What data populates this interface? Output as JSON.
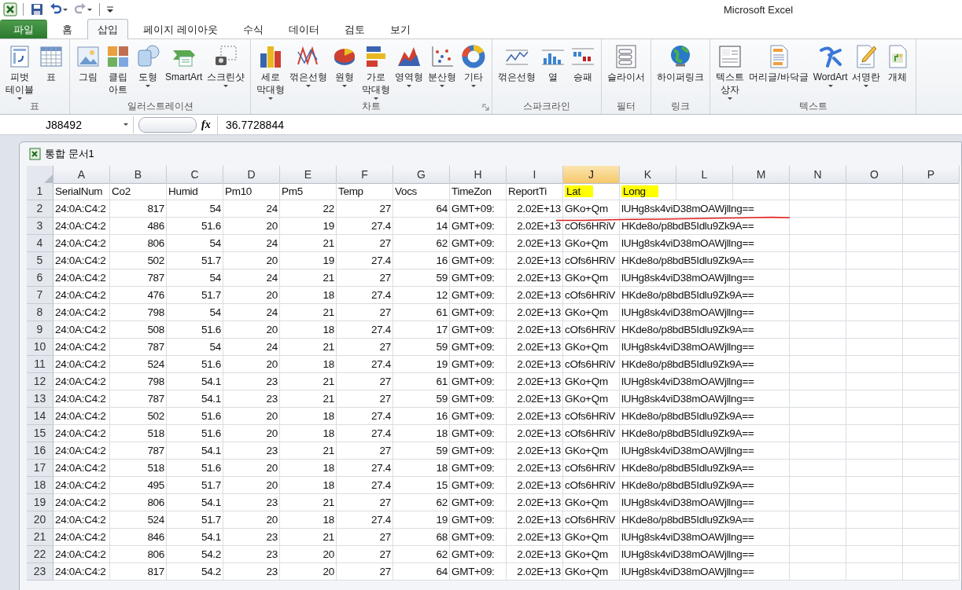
{
  "window": {
    "title": "Microsoft Excel"
  },
  "quick_access": [
    {
      "kind": "save",
      "dropdown": false
    },
    {
      "kind": "undo",
      "dropdown": true
    },
    {
      "kind": "redo",
      "dropdown": true
    },
    {
      "kind": "customize",
      "dropdown": false
    }
  ],
  "tabs": [
    {
      "label": "파일",
      "kind": "file",
      "selected": false
    },
    {
      "label": "홈",
      "kind": "tab",
      "selected": false
    },
    {
      "label": "삽입",
      "kind": "tab",
      "selected": true
    },
    {
      "label": "페이지 레이아웃",
      "kind": "tab",
      "selected": false
    },
    {
      "label": "수식",
      "kind": "tab",
      "selected": false
    },
    {
      "label": "데이터",
      "kind": "tab",
      "selected": false
    },
    {
      "label": "검토",
      "kind": "tab",
      "selected": false
    },
    {
      "label": "보기",
      "kind": "tab",
      "selected": false
    }
  ],
  "ribbon": {
    "groups": [
      {
        "label": "표",
        "launcher": false,
        "items": [
          {
            "label": "피벗\n테이블",
            "dropdown": true
          },
          {
            "label": "표",
            "dropdown": false
          }
        ]
      },
      {
        "label": "일러스트레이션",
        "launcher": false,
        "items": [
          {
            "label": "그림",
            "dropdown": false
          },
          {
            "label": "클립\n아트",
            "dropdown": false
          },
          {
            "label": "도형",
            "dropdown": true
          },
          {
            "label": "SmartArt",
            "dropdown": false
          },
          {
            "label": "스크린샷",
            "dropdown": true
          }
        ]
      },
      {
        "label": "차트",
        "launcher": true,
        "items": [
          {
            "label": "세로\n막대형",
            "dropdown": true
          },
          {
            "label": "꺾은선형",
            "dropdown": true
          },
          {
            "label": "원형",
            "dropdown": true
          },
          {
            "label": "가로\n막대형",
            "dropdown": true
          },
          {
            "label": "영역형",
            "dropdown": true
          },
          {
            "label": "분산형",
            "dropdown": true
          },
          {
            "label": "기타",
            "dropdown": true
          }
        ]
      },
      {
        "label": "스파크라인",
        "launcher": false,
        "items": [
          {
            "label": "꺾은선형",
            "dropdown": false
          },
          {
            "label": "열",
            "dropdown": false
          },
          {
            "label": "승패",
            "dropdown": false
          }
        ]
      },
      {
        "label": "필터",
        "launcher": false,
        "items": [
          {
            "label": "슬라이서",
            "dropdown": false
          }
        ]
      },
      {
        "label": "링크",
        "launcher": false,
        "items": [
          {
            "label": "하이퍼링크",
            "dropdown": false
          }
        ]
      },
      {
        "label": "텍스트",
        "launcher": false,
        "items": [
          {
            "label": "텍스트\n상자",
            "dropdown": true
          },
          {
            "label": "머리글/바닥글",
            "dropdown": false
          },
          {
            "label": "WordArt",
            "dropdown": true
          },
          {
            "label": "서명란",
            "dropdown": true
          },
          {
            "label": "개체",
            "dropdown": false
          }
        ]
      }
    ]
  },
  "formula_bar": {
    "name_box": "J88492",
    "fx": "fx",
    "value": "36.7728844"
  },
  "workbook": {
    "title": "통합 문서1"
  },
  "sheet": {
    "columns": [
      {
        "letter": "A",
        "selected": false,
        "numeric": false
      },
      {
        "letter": "B",
        "selected": false,
        "numeric": true
      },
      {
        "letter": "C",
        "selected": false,
        "numeric": true
      },
      {
        "letter": "D",
        "selected": false,
        "numeric": true
      },
      {
        "letter": "E",
        "selected": false,
        "numeric": true
      },
      {
        "letter": "F",
        "selected": false,
        "numeric": true
      },
      {
        "letter": "G",
        "selected": false,
        "numeric": true
      },
      {
        "letter": "H",
        "selected": false,
        "numeric": false
      },
      {
        "letter": "I",
        "selected": false,
        "numeric": true
      },
      {
        "letter": "J",
        "selected": true,
        "numeric": false
      },
      {
        "letter": "K",
        "selected": false,
        "numeric": false
      },
      {
        "letter": "L",
        "selected": false
      },
      {
        "letter": "M",
        "selected": false
      },
      {
        "letter": "N",
        "selected": false
      },
      {
        "letter": "O",
        "selected": false
      },
      {
        "letter": "P",
        "selected": false
      }
    ],
    "header_row": {
      "number": "1",
      "cells": [
        {
          "text": "SerialNum",
          "highlighted": false
        },
        {
          "text": "Co2",
          "highlighted": false
        },
        {
          "text": "Humid",
          "highlighted": false
        },
        {
          "text": "Pm10",
          "highlighted": false
        },
        {
          "text": "Pm5",
          "highlighted": false
        },
        {
          "text": "Temp",
          "highlighted": false
        },
        {
          "text": "Vocs",
          "highlighted": false
        },
        {
          "text": "TimeZon",
          "highlighted": false
        },
        {
          "text": "ReportTi",
          "highlighted": false
        },
        {
          "text": "Lat",
          "highlighted": true
        },
        {
          "text": "Long",
          "highlighted": true
        }
      ]
    },
    "rows": [
      {
        "number": "2",
        "cells": [
          "24:0A:C4:2",
          "817",
          "54",
          "24",
          "22",
          "27",
          "64",
          "GMT+09:",
          "2.02E+13",
          "GKo+Qm",
          "lUHg8sk4viD38mOAWjllng=="
        ]
      },
      {
        "number": "3",
        "cells": [
          "24:0A:C4:2",
          "486",
          "51.6",
          "20",
          "19",
          "27.4",
          "14",
          "GMT+09:",
          "2.02E+13",
          "cOfs6HRiV",
          "HKde8o/p8bdB5Idlu9Zk9A=="
        ]
      },
      {
        "number": "4",
        "cells": [
          "24:0A:C4:2",
          "806",
          "54",
          "24",
          "21",
          "27",
          "62",
          "GMT+09:",
          "2.02E+13",
          "GKo+Qm",
          "lUHg8sk4viD38mOAWjllng=="
        ]
      },
      {
        "number": "5",
        "cells": [
          "24:0A:C4:2",
          "502",
          "51.7",
          "20",
          "19",
          "27.4",
          "16",
          "GMT+09:",
          "2.02E+13",
          "cOfs6HRiV",
          "HKde8o/p8bdB5Idlu9Zk9A=="
        ]
      },
      {
        "number": "6",
        "cells": [
          "24:0A:C4:2",
          "787",
          "54",
          "24",
          "21",
          "27",
          "59",
          "GMT+09:",
          "2.02E+13",
          "GKo+Qm",
          "lUHg8sk4viD38mOAWjllng=="
        ]
      },
      {
        "number": "7",
        "cells": [
          "24:0A:C4:2",
          "476",
          "51.7",
          "20",
          "18",
          "27.4",
          "12",
          "GMT+09:",
          "2.02E+13",
          "cOfs6HRiV",
          "HKde8o/p8bdB5Idlu9Zk9A=="
        ]
      },
      {
        "number": "8",
        "cells": [
          "24:0A:C4:2",
          "798",
          "54",
          "24",
          "21",
          "27",
          "61",
          "GMT+09:",
          "2.02E+13",
          "GKo+Qm",
          "lUHg8sk4viD38mOAWjllng=="
        ]
      },
      {
        "number": "9",
        "cells": [
          "24:0A:C4:2",
          "508",
          "51.6",
          "20",
          "18",
          "27.4",
          "17",
          "GMT+09:",
          "2.02E+13",
          "cOfs6HRiV",
          "HKde8o/p8bdB5Idlu9Zk9A=="
        ]
      },
      {
        "number": "10",
        "cells": [
          "24:0A:C4:2",
          "787",
          "54",
          "24",
          "21",
          "27",
          "59",
          "GMT+09:",
          "2.02E+13",
          "GKo+Qm",
          "lUHg8sk4viD38mOAWjllng=="
        ]
      },
      {
        "number": "11",
        "cells": [
          "24:0A:C4:2",
          "524",
          "51.6",
          "20",
          "18",
          "27.4",
          "19",
          "GMT+09:",
          "2.02E+13",
          "cOfs6HRiV",
          "HKde8o/p8bdB5Idlu9Zk9A=="
        ]
      },
      {
        "number": "12",
        "cells": [
          "24:0A:C4:2",
          "798",
          "54.1",
          "23",
          "21",
          "27",
          "61",
          "GMT+09:",
          "2.02E+13",
          "GKo+Qm",
          "lUHg8sk4viD38mOAWjllng=="
        ]
      },
      {
        "number": "13",
        "cells": [
          "24:0A:C4:2",
          "787",
          "54.1",
          "23",
          "21",
          "27",
          "59",
          "GMT+09:",
          "2.02E+13",
          "GKo+Qm",
          "lUHg8sk4viD38mOAWjllng=="
        ]
      },
      {
        "number": "14",
        "cells": [
          "24:0A:C4:2",
          "502",
          "51.6",
          "20",
          "18",
          "27.4",
          "16",
          "GMT+09:",
          "2.02E+13",
          "cOfs6HRiV",
          "HKde8o/p8bdB5Idlu9Zk9A=="
        ]
      },
      {
        "number": "15",
        "cells": [
          "24:0A:C4:2",
          "518",
          "51.6",
          "20",
          "18",
          "27.4",
          "18",
          "GMT+09:",
          "2.02E+13",
          "cOfs6HRiV",
          "HKde8o/p8bdB5Idlu9Zk9A=="
        ]
      },
      {
        "number": "16",
        "cells": [
          "24:0A:C4:2",
          "787",
          "54.1",
          "23",
          "21",
          "27",
          "59",
          "GMT+09:",
          "2.02E+13",
          "GKo+Qm",
          "lUHg8sk4viD38mOAWjllng=="
        ]
      },
      {
        "number": "17",
        "cells": [
          "24:0A:C4:2",
          "518",
          "51.6",
          "20",
          "18",
          "27.4",
          "18",
          "GMT+09:",
          "2.02E+13",
          "cOfs6HRiV",
          "HKde8o/p8bdB5Idlu9Zk9A=="
        ]
      },
      {
        "number": "18",
        "cells": [
          "24:0A:C4:2",
          "495",
          "51.7",
          "20",
          "18",
          "27.4",
          "15",
          "GMT+09:",
          "2.02E+13",
          "cOfs6HRiV",
          "HKde8o/p8bdB5Idlu9Zk9A=="
        ]
      },
      {
        "number": "19",
        "cells": [
          "24:0A:C4:2",
          "806",
          "54.1",
          "23",
          "21",
          "27",
          "62",
          "GMT+09:",
          "2.02E+13",
          "GKo+Qm",
          "lUHg8sk4viD38mOAWjllng=="
        ]
      },
      {
        "number": "20",
        "cells": [
          "24:0A:C4:2",
          "524",
          "51.7",
          "20",
          "18",
          "27.4",
          "19",
          "GMT+09:",
          "2.02E+13",
          "cOfs6HRiV",
          "HKde8o/p8bdB5Idlu9Zk9A=="
        ]
      },
      {
        "number": "21",
        "cells": [
          "24:0A:C4:2",
          "846",
          "54.1",
          "23",
          "21",
          "27",
          "68",
          "GMT+09:",
          "2.02E+13",
          "GKo+Qm",
          "lUHg8sk4viD38mOAWjllng=="
        ]
      },
      {
        "number": "22",
        "cells": [
          "24:0A:C4:2",
          "806",
          "54.2",
          "23",
          "20",
          "27",
          "62",
          "GMT+09:",
          "2.02E+13",
          "GKo+Qm",
          "lUHg8sk4viD38mOAWjllng=="
        ]
      },
      {
        "number": "23",
        "cells": [
          "24:0A:C4:2",
          "817",
          "54.2",
          "23",
          "20",
          "27",
          "64",
          "GMT+09:",
          "2.02E+13",
          "GKo+Qm",
          "lUHg8sk4viD38mOAWjllng=="
        ]
      }
    ]
  }
}
